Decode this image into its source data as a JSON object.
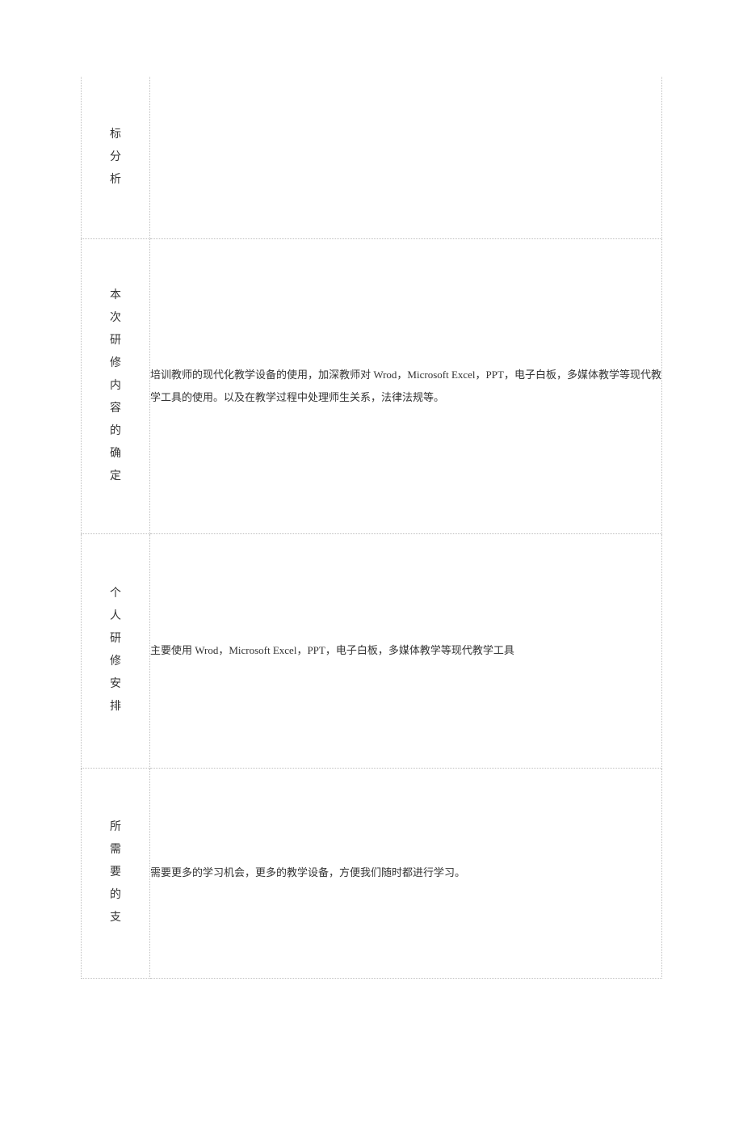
{
  "rows": [
    {
      "label": "标分析",
      "content": ""
    },
    {
      "label": "本次研修内容的确定",
      "content": "培训教师的现代化教学设备的使用，加深教师对 Wrod，Microsoft Excel，PPT，电子白板，多媒体教学等现代教学工具的使用。以及在教学过程中处理师生关系，法律法规等。"
    },
    {
      "label": "个人研修安排",
      "content": "主要使用 Wrod，Microsoft Excel，PPT，电子白板，多媒体教学等现代教学工具"
    },
    {
      "label": "所需要的支",
      "content": "需要更多的学习机会，更多的教学设备，方便我们随时都进行学习。"
    }
  ]
}
